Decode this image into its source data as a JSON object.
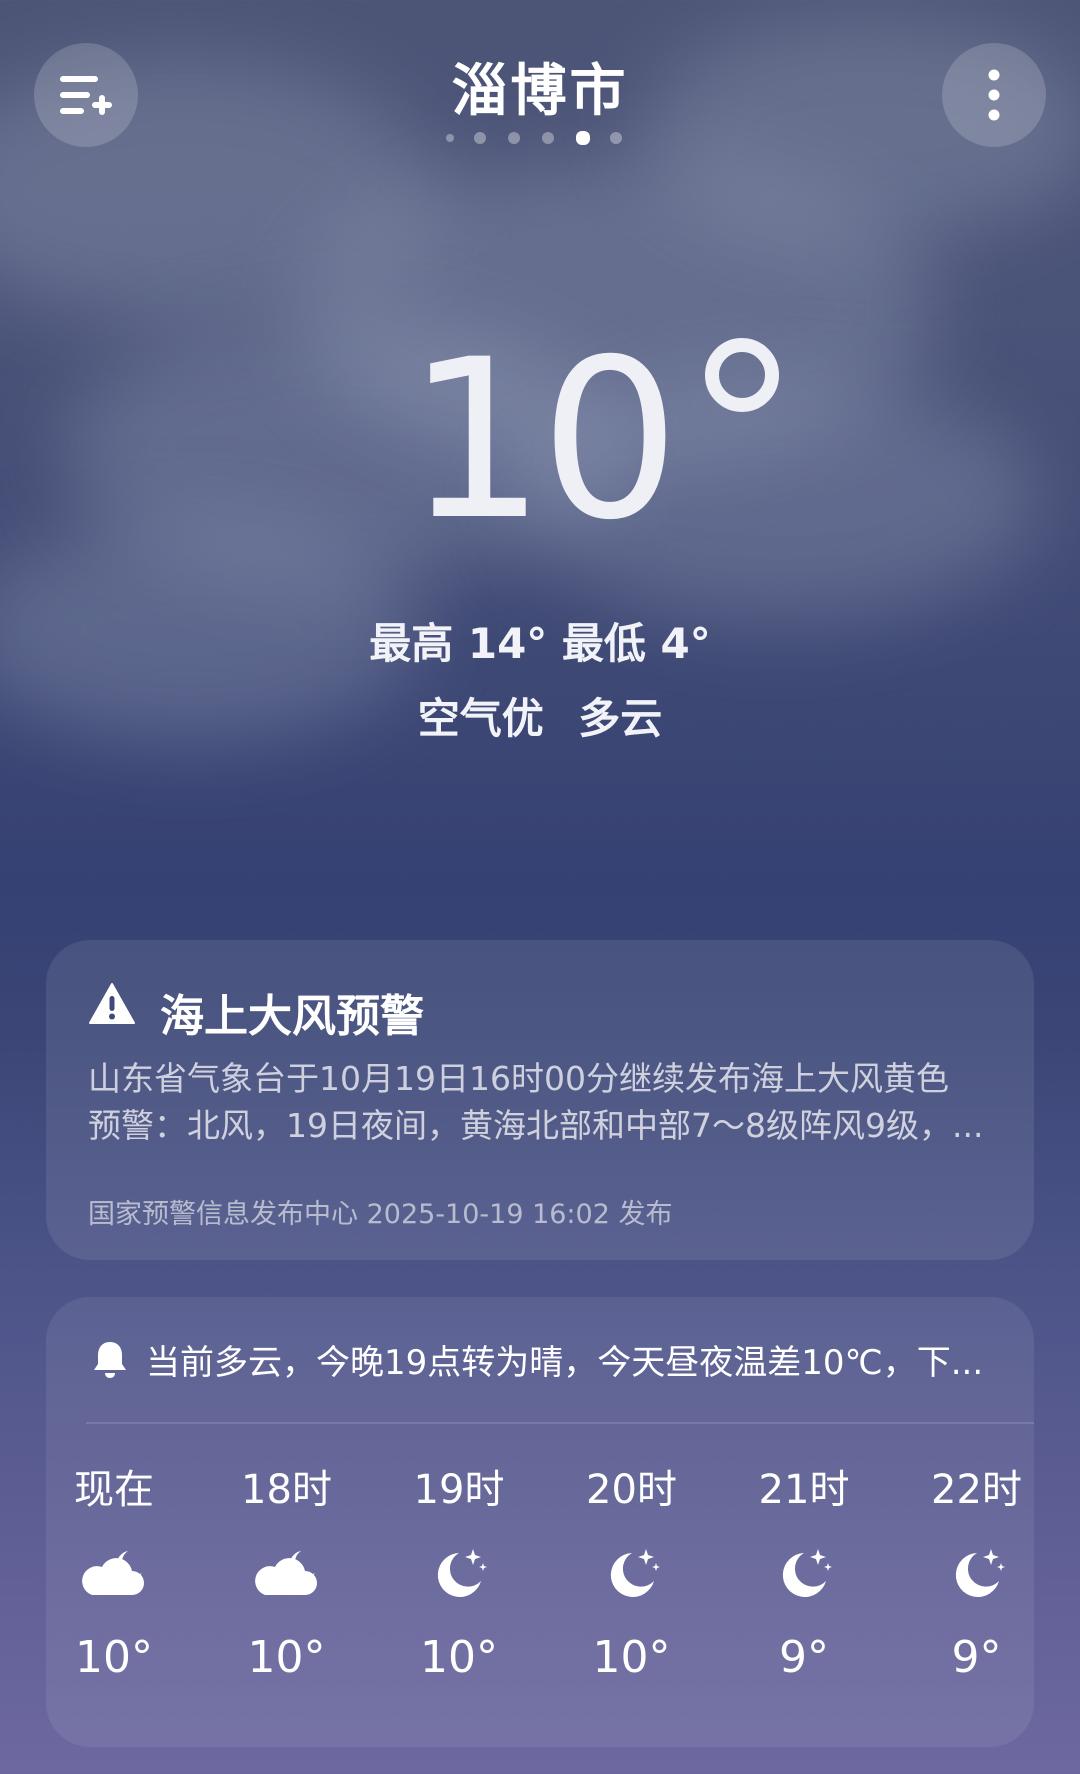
{
  "header": {
    "city": "淄博市",
    "menu_icon": "list-add-icon",
    "more_icon": "more-vertical-icon",
    "page_dots_total": 6,
    "page_dots_active_index": 4
  },
  "current": {
    "temperature": "10",
    "high_low": "最高 14° 最低 4°",
    "condition": "空气优 多云"
  },
  "alert": {
    "title": "海上大风预警",
    "icon": "warning-icon",
    "body_line1": "山东省气象台于10月19日16时00分继续发布海上大风黄色",
    "body_line2": "预警：北风，19日夜间，黄海北部和中部7～8级阵风9级，...",
    "source": "国家预警信息发布中心 2025-10-19 16:02 发布"
  },
  "hourly": {
    "summary_icon": "bell-icon",
    "summary": "当前多云，今晚19点转为晴，今天昼夜温差10℃，下...",
    "hours": [
      {
        "label": "现在",
        "icon": "cloudy-night-icon",
        "temp": "10°"
      },
      {
        "label": "18时",
        "icon": "cloudy-night-icon",
        "temp": "10°"
      },
      {
        "label": "19时",
        "icon": "clear-night-icon",
        "temp": "10°"
      },
      {
        "label": "20时",
        "icon": "clear-night-icon",
        "temp": "10°"
      },
      {
        "label": "21时",
        "icon": "clear-night-icon",
        "temp": "9°"
      },
      {
        "label": "22时",
        "icon": "clear-night-icon",
        "temp": "9°"
      }
    ]
  },
  "colors": {
    "card_bg": "rgba(255,255,255,0.08)",
    "text": "#ffffff"
  }
}
